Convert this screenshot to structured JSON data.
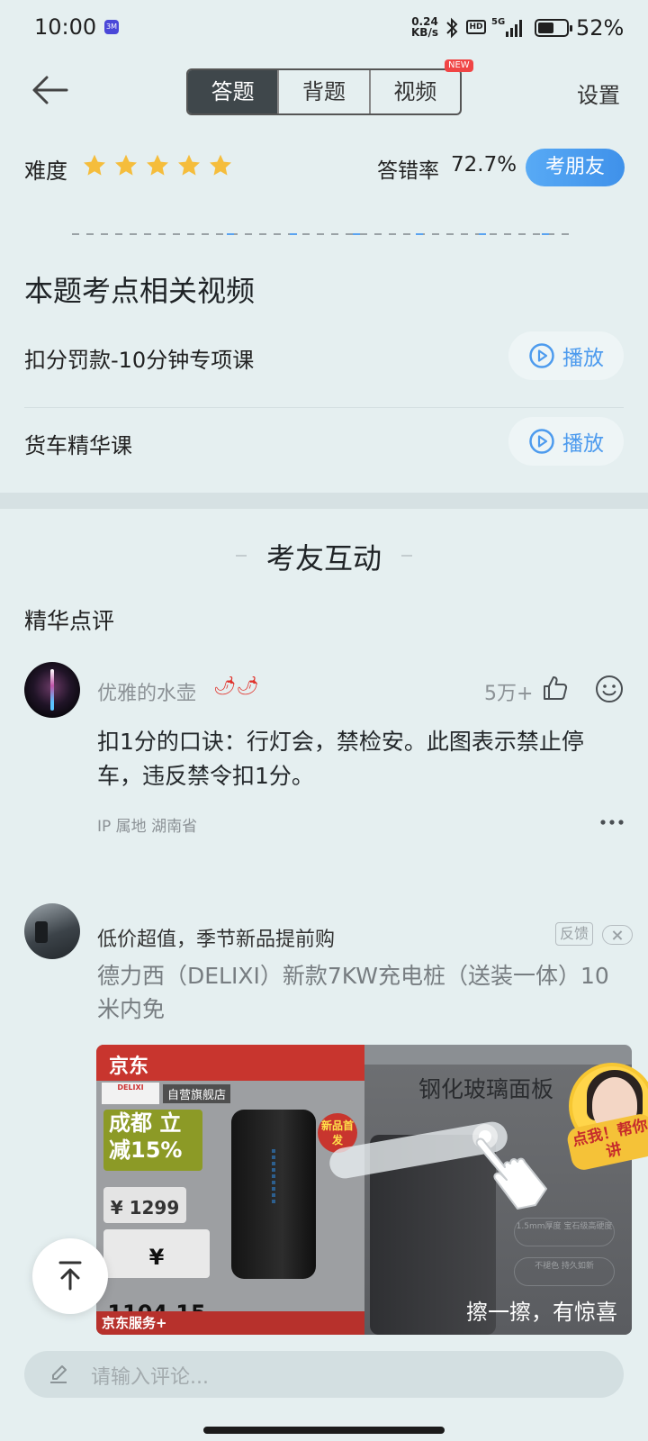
{
  "status_bar": {
    "time": "10:00",
    "app_badge": "3M",
    "net_speed_value": "0.24",
    "net_speed_unit": "KB/s",
    "hd_label": "HD",
    "network": "5G",
    "battery": "52%",
    "battery_level": 0.52
  },
  "header": {
    "tabs": [
      "答题",
      "背题",
      "视频"
    ],
    "active_tab": 0,
    "new_badge": "NEW",
    "settings": "设置"
  },
  "difficulty": {
    "label": "难度",
    "stars": 5,
    "max_stars": 5,
    "error_rate_label": "答错率",
    "error_rate_value": "72.7%",
    "exam_friend_button": "考朋友"
  },
  "videos": {
    "title": "本题考点相关视频",
    "items": [
      {
        "name": "扣分罚款-10分钟专项课",
        "play_label": "播放"
      },
      {
        "name": "货车精华课",
        "play_label": "播放"
      }
    ]
  },
  "interaction": {
    "title": "考友互动",
    "featured_label": "精华点评"
  },
  "comment": {
    "username": "优雅的水壶",
    "username_emoji": "🌶🌶",
    "likes": "5万+",
    "text": "扣1分的口诀：行灯会，禁检安。此图表示禁止停车，违反禁令扣1分。",
    "ip": "IP 属地 湖南省"
  },
  "ad": {
    "headline": "低价超值，季节新品提前购",
    "feedback": "反馈",
    "title": "德力西（DELIXI）新款7KW充电桩（送装一体）10米内免",
    "jd_logo": "京东",
    "brand_box": "DELIXI",
    "store_tag": "自营旗舰店",
    "promo": "成都 立减15%",
    "price_1": "¥ 1299",
    "price_2": "¥ 1104.15",
    "new_first": "新品首发",
    "service": "京东服务+",
    "glass_text": "钢化玻璃面板",
    "feature_1": "1.5mm厚度 宝石级高硬度",
    "feature_2": "不褪色 持久如新",
    "scratch_text": "擦一擦，有惊喜"
  },
  "help_badge": {
    "label": "点我！帮你讲"
  },
  "footer": {
    "comment_placeholder": "请输入评论..."
  },
  "colors": {
    "background": "#e5eff0",
    "accent_blue": "#4d9bee",
    "star": "#f5bd3c",
    "active_tab": "#3f474b",
    "new_badge": "#f04545"
  }
}
